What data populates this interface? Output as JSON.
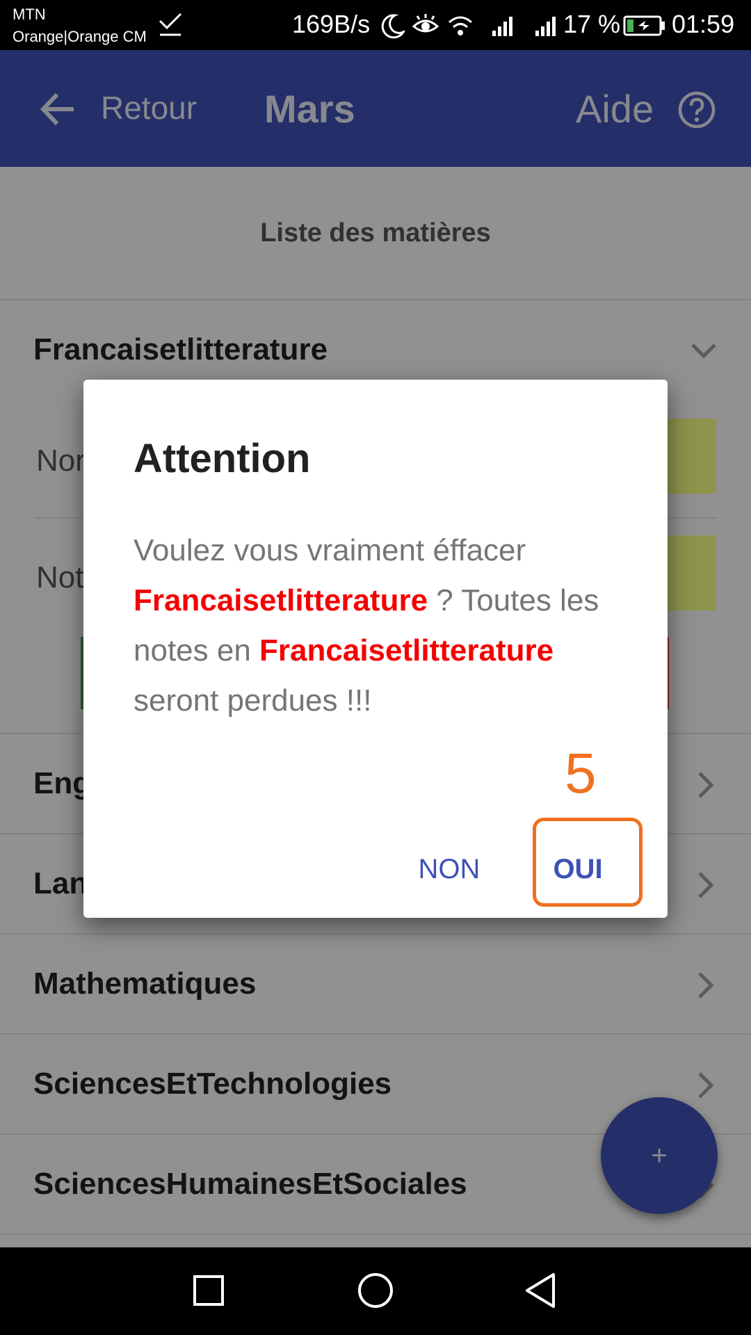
{
  "status_bar": {
    "carrier_line1": "MTN",
    "carrier_line2": "Orange|Orange CM",
    "net_speed": "169B/s",
    "battery_percent": "17 %",
    "time": "01:59"
  },
  "app_bar": {
    "back_label": "Retour",
    "title": "Mars",
    "help_label": "Aide"
  },
  "list": {
    "header": "Liste des matières",
    "expanded_subject": "Francaisetlitterature",
    "partial_field_1": "Nor",
    "partial_field_2": "Not",
    "partial_rows": [
      "Eng",
      "Lan"
    ],
    "subjects": [
      "Mathematiques",
      "SciencesEtTechnologies",
      "SciencesHumainesEtSociales"
    ]
  },
  "dialog": {
    "title": "Attention",
    "message_part1": "Voulez vous vraiment éffacer ",
    "highlight_subject": "Francaisetlitterature",
    "message_part2": " ? Toutes les notes en ",
    "message_part3": " seront perdues !!!",
    "no_label": "NON",
    "yes_label": "OUI"
  },
  "fab": {
    "label": "+"
  },
  "annotation": {
    "step_number": "5"
  },
  "colors": {
    "primary": "#3f51b5",
    "highlight": "#f40000",
    "annotation": "#f07020",
    "field_box": "#f4ff81"
  }
}
